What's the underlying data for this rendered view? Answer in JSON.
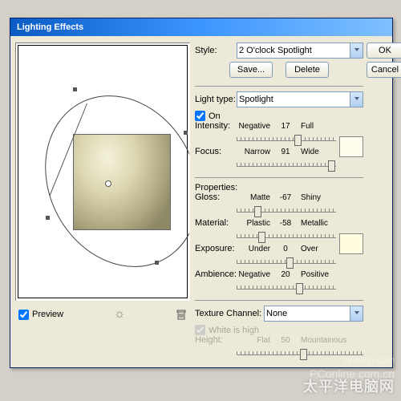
{
  "titlebar": "Lighting Effects",
  "style": {
    "label": "Style:",
    "value": "2 O'clock Spotlight"
  },
  "ok": "OK",
  "cancel": "Cancel",
  "save": "Save...",
  "delete": "Delete",
  "light_type": {
    "label": "Light type:",
    "value": "Spotlight"
  },
  "on": "On",
  "intensity": {
    "lbl": "Intensity:",
    "ll": "Negative",
    "val": "17",
    "rl": "Full",
    "pos": 58
  },
  "focus": {
    "lbl": "Focus:",
    "ll": "Narrow",
    "val": "91",
    "rl": "Wide",
    "pos": 92
  },
  "properties": "Properties:",
  "gloss": {
    "lbl": "Gloss:",
    "ll": "Matte",
    "val": "-67",
    "rl": "Shiny",
    "pos": 18
  },
  "material": {
    "lbl": "Material:",
    "ll": "Plastic",
    "val": "-58",
    "rl": "Metallic",
    "pos": 22
  },
  "exposure": {
    "lbl": "Exposure:",
    "ll": "Under",
    "val": "0",
    "rl": "Over",
    "pos": 50
  },
  "ambience": {
    "lbl": "Ambience:",
    "ll": "Negative",
    "val": "20",
    "rl": "Positive",
    "pos": 60
  },
  "texture": {
    "label": "Texture Channel:",
    "value": "None"
  },
  "white": "White is high",
  "height": {
    "lbl": "Height:",
    "ll": "Flat",
    "val": "50",
    "rl": "Mountainous",
    "pos": 50
  },
  "preview": "Preview",
  "wm1": "太平洋电脑网",
  "wm2": "PConline.com.cn",
  "wm3": "redocn.com"
}
